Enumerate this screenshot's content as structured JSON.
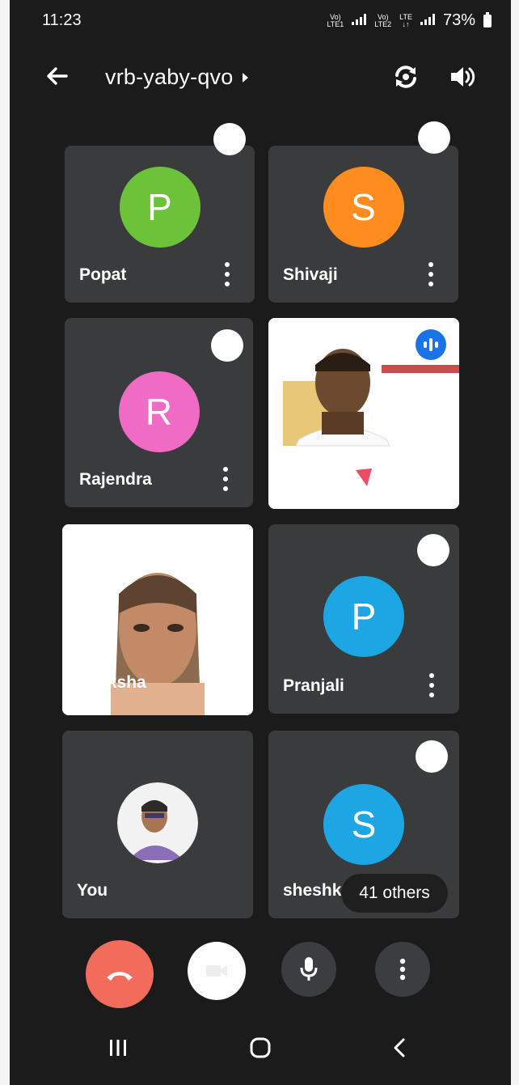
{
  "status_bar": {
    "time": "11:23",
    "net1": "Vo)\nLTE1",
    "net2": "Vo)\nLTE2",
    "lte": "LTE\n↓↑",
    "battery": "73%"
  },
  "header": {
    "meeting_code": "vrb-yaby-qvo"
  },
  "participants": [
    {
      "name": "Popat",
      "initial": "P",
      "color": "#6cc33a"
    },
    {
      "name": "Shivaji",
      "initial": "S",
      "color": "#ff8c1f"
    },
    {
      "name": "Rajendra",
      "initial": "R",
      "color": "#f06cc4"
    },
    {
      "name": "",
      "video": true
    },
    {
      "name": "iksha",
      "video": true
    },
    {
      "name": "Pranjali",
      "initial": "P",
      "color": "#1ca7e4"
    },
    {
      "name": "You",
      "photo": true
    },
    {
      "name": "sheshkumar",
      "initial": "S",
      "color": "#1ca7e4"
    }
  ],
  "others_label": "41 others",
  "colors": {
    "end_call": "#f26b5b",
    "panel": "#3a3b3d"
  },
  "icons": [
    "back-arrow-icon",
    "switch-camera-icon",
    "speaker-icon",
    "end-call-icon",
    "camera-off-icon",
    "microphone-icon",
    "more-vert-icon",
    "recents-icon",
    "home-icon",
    "back-nav-icon"
  ]
}
